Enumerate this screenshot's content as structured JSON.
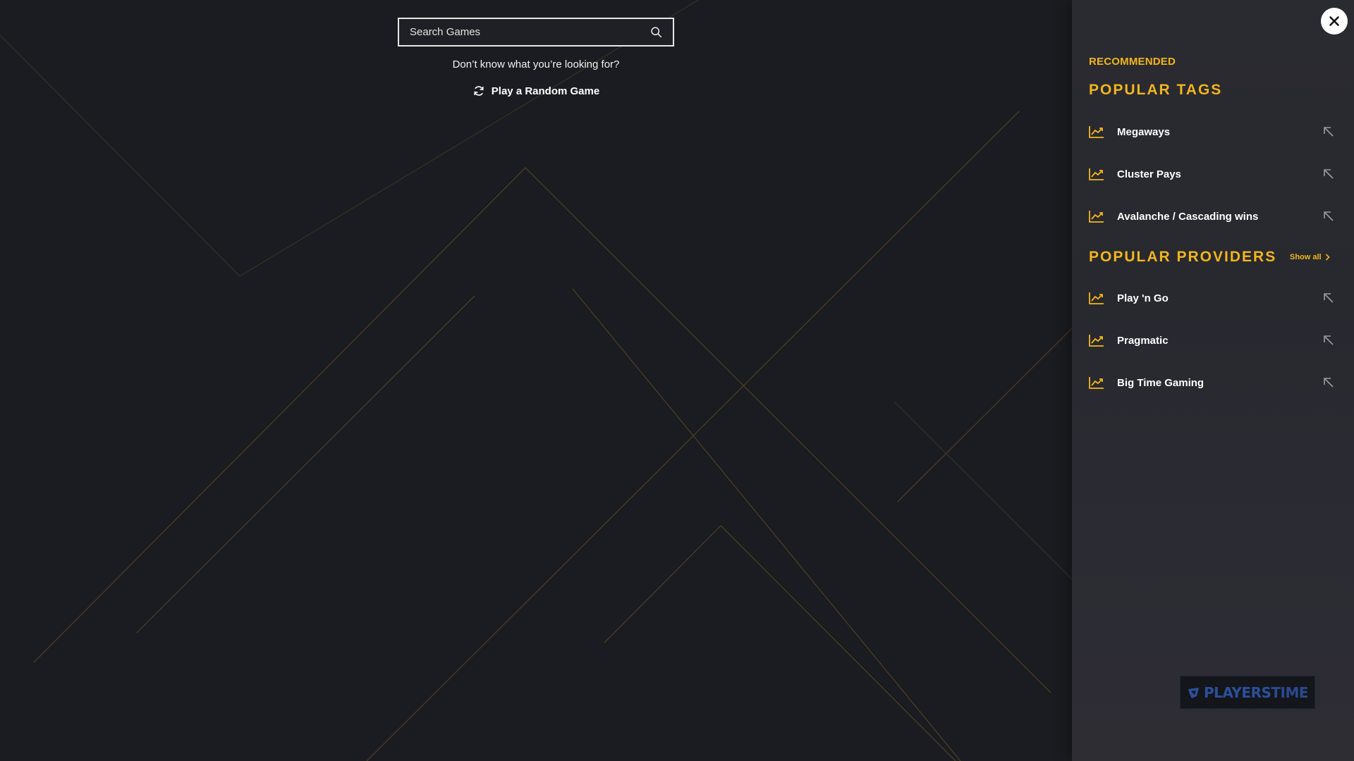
{
  "search": {
    "placeholder": "Search Games"
  },
  "hint_text": "Don’t know what you’re looking for?",
  "random_game_label": "Play a Random Game",
  "panel": {
    "recommended_label": "RECOMMENDED",
    "popular_tags": {
      "title": "POPULAR TAGS",
      "items": [
        {
          "label": "Megaways"
        },
        {
          "label": "Cluster Pays"
        },
        {
          "label": "Avalanche / Cascading wins"
        }
      ]
    },
    "popular_providers": {
      "title": "POPULAR PROVIDERS",
      "show_all_label": "Show all",
      "items": [
        {
          "label": "Play 'n Go"
        },
        {
          "label": "Pragmatic"
        },
        {
          "label": "Big Time Gaming"
        }
      ]
    },
    "logo": {
      "part1": "PLAYERS",
      "part2": "TIME"
    }
  },
  "icons": {
    "search": "search-icon",
    "refresh": "refresh-icon",
    "close": "close-icon",
    "trend": "trending-up-icon",
    "arrow": "arrow-up-left-icon",
    "chevron": "chevron-right-icon"
  },
  "colors": {
    "background": "#1b1c21",
    "panel": "#2a2b31",
    "accent": "#f2b51e",
    "text": "#ffffff"
  }
}
